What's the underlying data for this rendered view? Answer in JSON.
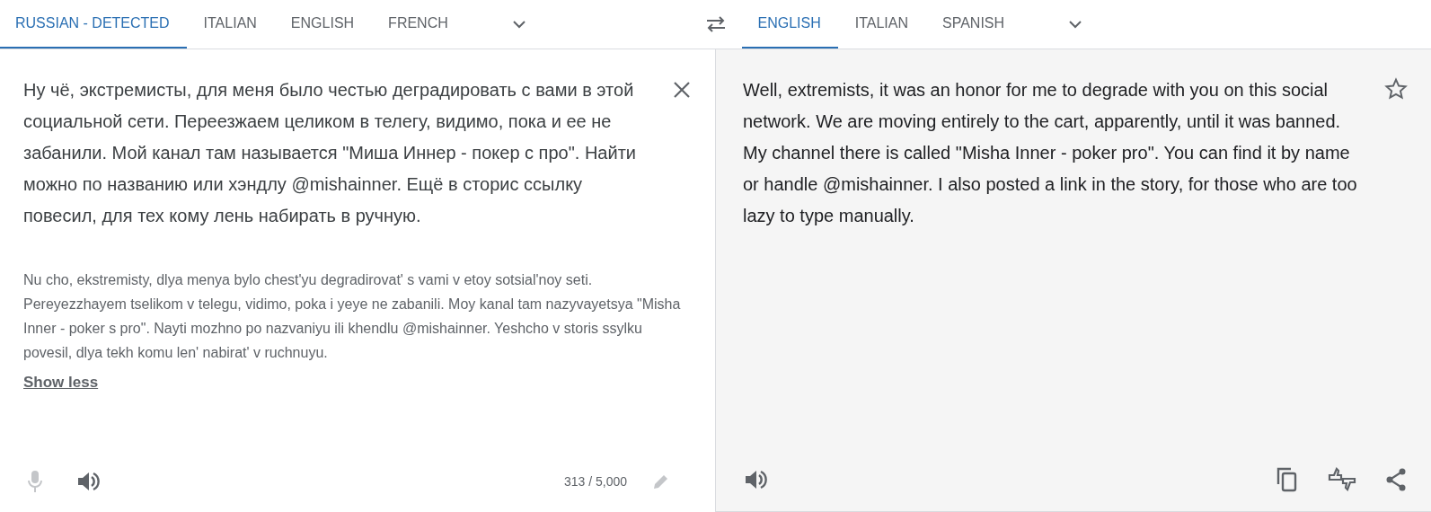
{
  "source_tabs": [
    {
      "label": "RUSSIAN - DETECTED",
      "selected": true
    },
    {
      "label": "ITALIAN",
      "selected": false
    },
    {
      "label": "ENGLISH",
      "selected": false
    },
    {
      "label": "FRENCH",
      "selected": false
    }
  ],
  "target_tabs": [
    {
      "label": "ENGLISH",
      "selected": true
    },
    {
      "label": "ITALIAN",
      "selected": false
    },
    {
      "label": "SPANISH",
      "selected": false
    }
  ],
  "source": {
    "text": "Ну чё, экстремисты, для меня было честью деградировать с вами в этой социальной сети. Переезжаем целиком в телегу, видимо, пока и ее не забанили. Мой канал там называется \"Миша Иннер - покер с про\". Найти можно по названию или хэндлу @mishainner. Ещё в сторис ссылку повесил, для тех кому лень набирать в ручную.",
    "transliteration": "Nu cho, ekstremisty, dlya menya bylo chest'yu degradirovat' s vami v etoy sotsial'noy seti. Pereyezzhayem tselikom v telegu, vidimo, poka i yeye ne zabanili. Moy kanal tam nazyvayetsya \"Misha Inner - poker s pro\". Nayti mozhno po nazvaniyu ili khendlu @mishainner. Yeshcho v storis ssylku povesil, dlya tekh komu len' nabirat' v ruchnuyu.",
    "toggle_link": "Show less",
    "char_count": "313 / 5,000",
    "mic_disabled": true
  },
  "target": {
    "text": "Well, extremists, it was an honor for me to degrade with you on this social network. We are moving entirely to the cart, apparently, until it was banned. My channel there is called \"Misha Inner - poker pro\". You can find it by name or handle @mishainner. I also posted a link in the story, for those who are too lazy to type manually.",
    "starred": false
  }
}
